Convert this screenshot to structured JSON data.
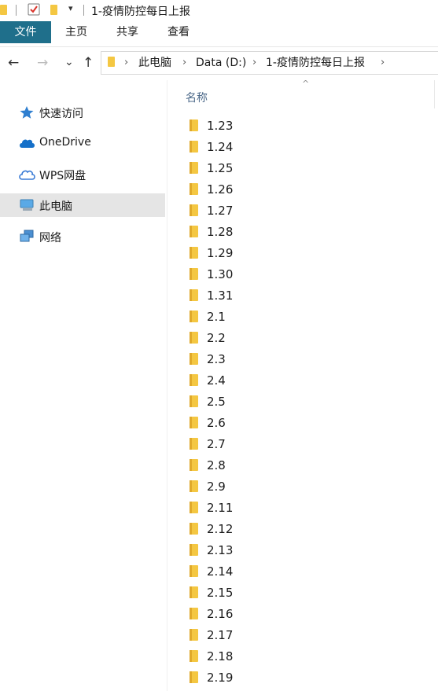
{
  "window": {
    "title": "1-疫情防控每日上报",
    "quick_access_dropdown": "▾"
  },
  "ribbon": {
    "tabs": [
      {
        "label": "文件"
      },
      {
        "label": "主页"
      },
      {
        "label": "共享"
      },
      {
        "label": "查看"
      }
    ]
  },
  "navigation": {
    "back": "←",
    "forward": "→",
    "recent": "⌄",
    "up": "↑",
    "breadcrumb": [
      "此电脑",
      "Data (D:)",
      "1-疫情防控每日上报"
    ]
  },
  "sidebar": {
    "items": [
      {
        "label": "快速访问",
        "icon": "star-icon",
        "selected": false
      },
      {
        "label": "OneDrive",
        "icon": "cloud-icon",
        "selected": false
      },
      {
        "label": "WPS网盘",
        "icon": "wps-cloud-icon",
        "selected": false
      },
      {
        "label": "此电脑",
        "icon": "computer-icon",
        "selected": true
      },
      {
        "label": "网络",
        "icon": "network-icon",
        "selected": false
      }
    ]
  },
  "content": {
    "column_header": "名称",
    "sort_indicator": "^",
    "files": [
      "1.23",
      "1.24",
      "1.25",
      "1.26",
      "1.27",
      "1.28",
      "1.29",
      "1.30",
      "1.31",
      "2.1",
      "2.2",
      "2.3",
      "2.4",
      "2.5",
      "2.6",
      "2.7",
      "2.8",
      "2.9",
      "2.11",
      "2.12",
      "2.13",
      "2.14",
      "2.15",
      "2.16",
      "2.17",
      "2.18",
      "2.19"
    ]
  },
  "colors": {
    "file_tab": "#1f6f8b",
    "folder": "#f4c742",
    "selected_bg": "#e5e5e5",
    "header_text": "#4d6a8a"
  }
}
